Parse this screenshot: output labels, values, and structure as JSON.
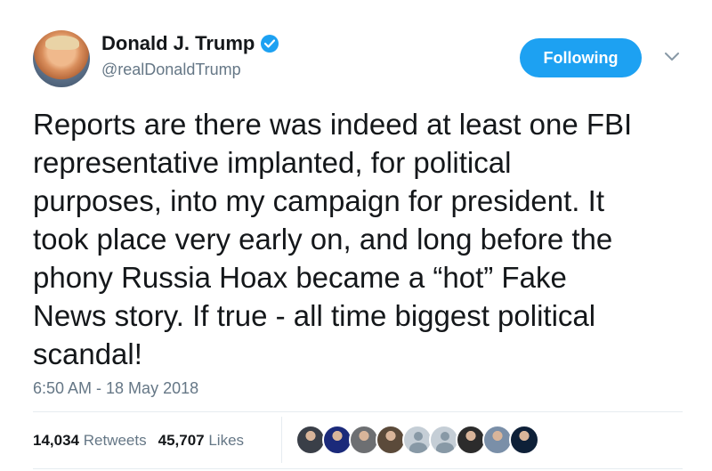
{
  "user": {
    "name": "Donald J. Trump",
    "handle": "@realDonaldTrump"
  },
  "follow_button": {
    "label": "Following"
  },
  "tweet": {
    "text": "Reports are there was indeed at least one FBI\nrepresentative implanted, for political\npurposes, into my campaign for president. It\ntook place very early on, and long before the\nphony Russia Hoax became a “hot” Fake\nNews story. If true - all time biggest political\nscandal!",
    "timestamp": "6:50 AM - 18 May 2018"
  },
  "stats": {
    "retweets_count": "14,034",
    "retweets_label": "Retweets",
    "likes_count": "45,707",
    "likes_label": "Likes"
  },
  "likers": [
    {
      "icon": "user-avatar",
      "color": "#3a3f48"
    },
    {
      "icon": "user-avatar",
      "color": "#1b2a7a"
    },
    {
      "icon": "user-avatar",
      "color": "#6d6f72"
    },
    {
      "icon": "user-avatar",
      "color": "#5b4a3a"
    },
    {
      "icon": "default-avatar",
      "color": "#c5ced6"
    },
    {
      "icon": "default-avatar",
      "color": "#c5ced6"
    },
    {
      "icon": "user-avatar",
      "color": "#2c2c2c"
    },
    {
      "icon": "user-avatar",
      "color": "#7a8fa8"
    },
    {
      "icon": "user-avatar",
      "color": "#0e2038"
    }
  ],
  "colors": {
    "accent": "#1da1f2",
    "text": "#14171a",
    "secondary": "#657786",
    "divider": "#e6ecf0"
  }
}
